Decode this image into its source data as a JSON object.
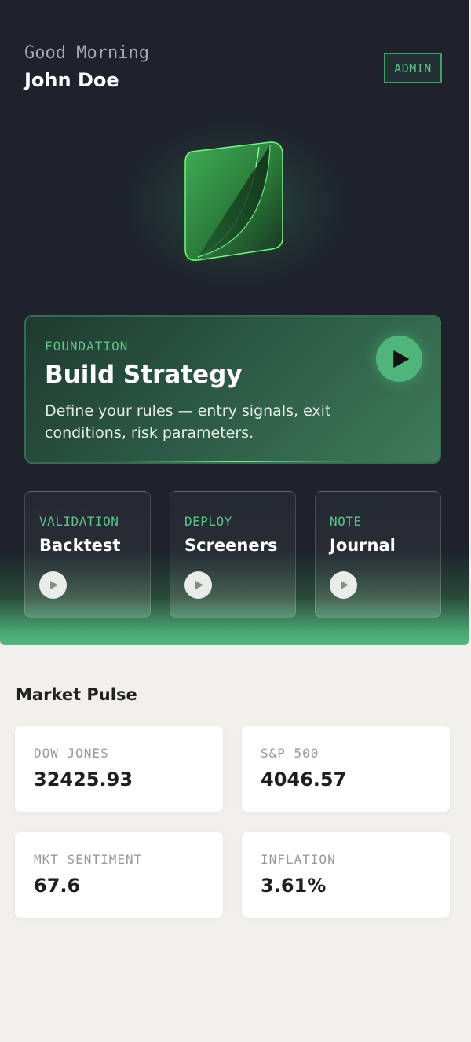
{
  "header": {
    "greeting": "Good Morning",
    "user_name": "John Doe",
    "role_badge": "ADMIN"
  },
  "brand": {
    "logo_icon": "green-leaf-tile-icon",
    "accent_color": "#4fb57b"
  },
  "feature": {
    "kicker": "FOUNDATION",
    "title": "Build Strategy",
    "description": "Define your rules — entry signals, exit conditions, risk parameters.",
    "action_icon": "play-icon"
  },
  "modules": [
    {
      "kicker": "VALIDATION",
      "title": "Backtest",
      "action_icon": "play-icon"
    },
    {
      "kicker": "DEPLOY",
      "title": "Screeners",
      "action_icon": "play-icon"
    },
    {
      "kicker": "NOTE",
      "title": "Journal",
      "action_icon": "play-icon"
    }
  ],
  "market": {
    "title": "Market Pulse",
    "stats": [
      {
        "label": "DOW JONES",
        "value": "32425.93"
      },
      {
        "label": "S&P 500",
        "value": "4046.57"
      },
      {
        "label": "MKT SENTIMENT",
        "value": "67.6"
      },
      {
        "label": "INFLATION",
        "value": "3.61%"
      }
    ]
  }
}
